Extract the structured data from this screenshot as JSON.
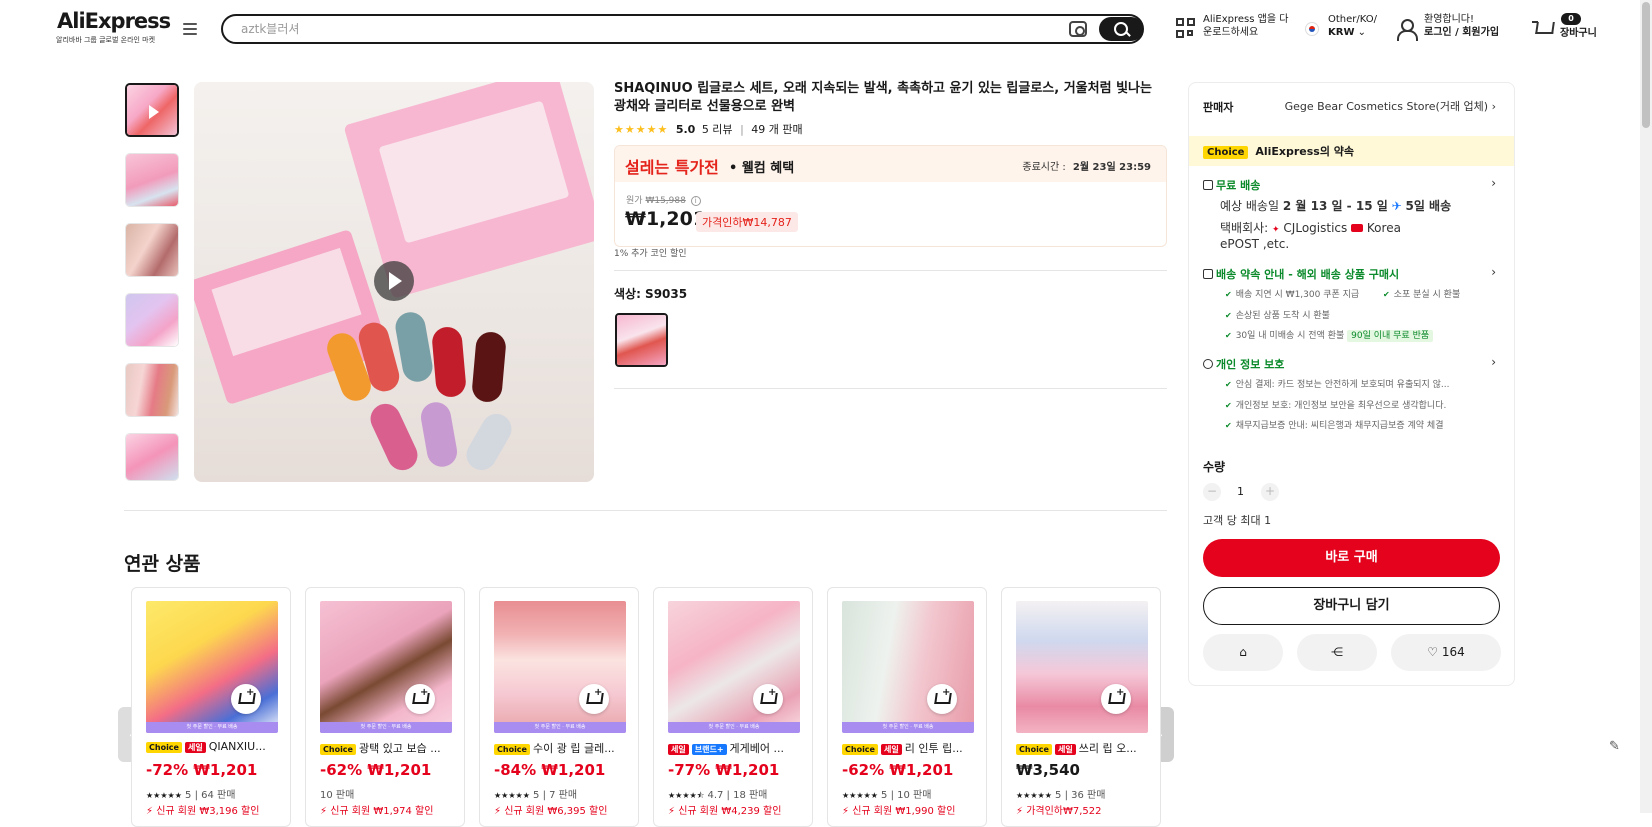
{
  "header": {
    "logo": "AliExpress",
    "logo_sub": "알리바바 그룹 글로벌 온라인 마켓",
    "search_placeholder": "aztk블러셔",
    "app_download_line1": "AliExpress 앱을 다",
    "app_download_line2": "운로드하세요",
    "region_line1": "Other/KO/",
    "region_line2": "KRW",
    "welcome_line1": "환영합니다!",
    "welcome_line2": "로그인 / 회원가입",
    "cart_count": "0",
    "cart_label": "장바구니"
  },
  "product": {
    "title": "SHAQINUO 립글로스 세트, 오래 지속되는 발색, 촉촉하고 윤기 있는 립글로스, 거울처럼 빛나는 광채와 글리터로 선물용으로 완벽",
    "stars": "★★★★★",
    "rating": "5.0",
    "reviews": "5 리뷰",
    "sold": "49 개 판매",
    "promo_logo": "설레는 특가전",
    "promo_welcome": "• 웰컴 혜택",
    "end_label": "종료시간 :",
    "end_time": "2월 23일 23:59",
    "orig_label": "원가",
    "orig_price": "₩15,988",
    "price": "₩1,201",
    "discount": "가격인하₩14,787",
    "coin_note": "1% 추가 코인 할인",
    "color_label": "색상: S9035"
  },
  "panel": {
    "seller_label": "판매자",
    "seller_name": "Gege Bear Cosmetics Store(거래 업체)",
    "choice_badge": "Choice",
    "choice_promise": "AliExpress의 약속",
    "free_ship": "무료 배송",
    "eta_prefix": "예상 배송일",
    "eta_dates": "2 월 13 일 - 15 일",
    "eta_days": "5일 배송",
    "carrier_label": "택배회사:",
    "carrier1": "CJLogistics",
    "carrier2": "Korea",
    "carrier3": "ePOST ,etc.",
    "promise_title": "배송 약속 안내 - 해외 배송 상품 구매시",
    "promise_items": [
      "배송 지연 시 ₩1,300 쿠폰 지급",
      "소포 분실 시 환불",
      "손상된 상품 도착 시 환불",
      "30일 내 미배송 시 전액 환불"
    ],
    "free_return": "90일 이내 무료 반품",
    "privacy_title": "개인 정보 보호",
    "privacy_items": [
      "안심 결제: 카드 정보는 안전하게 보호되며 유출되지 않...",
      "개인정보 보호: 개인정보 보안을 최우선으로 생각합니다.",
      "채무지급보증 안내: 씨티은행과 채무지급보증 계약 체결"
    ],
    "qty_label": "수량",
    "qty_minus": "−",
    "qty_value": "1",
    "qty_plus": "+",
    "qty_max": "고객 당 최대 1",
    "buy_now": "바로 구매",
    "add_cart": "장바구니 담기",
    "wish_count": "164"
  },
  "related": {
    "title": "연관 상품",
    "strip_text": "첫 주문 할인 · 무료 배송",
    "items": [
      {
        "badges": [
          "Choice",
          "세일"
        ],
        "name": "QIANXIU...",
        "price": "-72% ₩1,201",
        "meta_stars": "★★★★★",
        "meta": "5 | 64 판매",
        "promo": "신규 회원 ₩3,196 할인"
      },
      {
        "badges": [
          "Choice"
        ],
        "name": "광택 있고 보습 ...",
        "price": "-62% ₩1,201",
        "meta_stars": "",
        "meta": "10 판매",
        "promo": "신규 회원 ₩1,974 할인"
      },
      {
        "badges": [
          "Choice"
        ],
        "name": "수이 광 립 글레...",
        "price": "-84% ₩1,201",
        "meta_stars": "★★★★★",
        "meta": "5 | 7 판매",
        "promo": "신규 회원 ₩6,395 할인"
      },
      {
        "badges": [
          "세일",
          "브랜드+"
        ],
        "name": "게게베어 ...",
        "price": "-77% ₩1,201",
        "meta_stars": "★★★★⯪",
        "meta": "4.7 | 18 판매",
        "promo": "신규 회원 ₩4,239 할인"
      },
      {
        "badges": [
          "Choice",
          "세일"
        ],
        "name": "리 인투 립...",
        "price": "-62% ₩1,201",
        "meta_stars": "★★★★★",
        "meta": "5 | 10 판매",
        "promo": "신규 회원 ₩1,990 할인"
      },
      {
        "badges": [
          "Choice",
          "세일"
        ],
        "name": "쓰리 립 오...",
        "price": "₩3,540",
        "meta_stars": "★★★★★",
        "meta": "5 | 36 판매",
        "promo": "가격인하₩7,522"
      }
    ]
  }
}
